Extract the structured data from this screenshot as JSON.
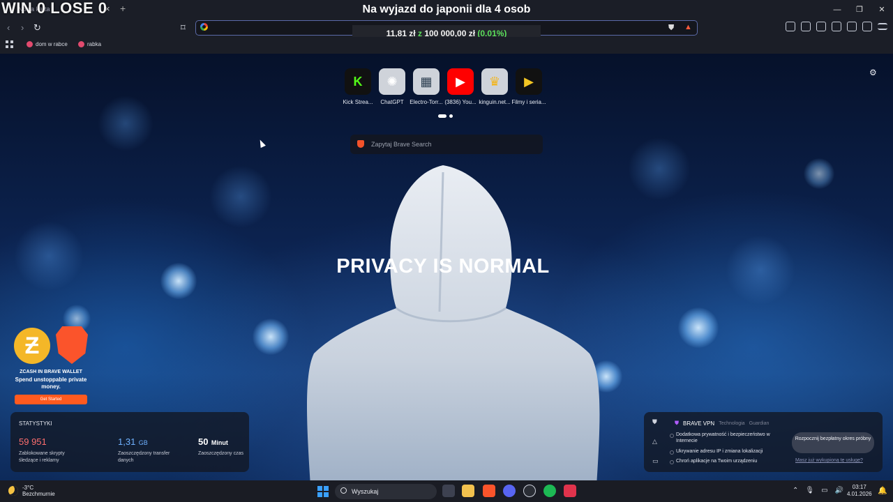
{
  "overlay": {
    "score": "WIN 0 LOSE 0"
  },
  "window": {
    "title": "Na wyjazd do japonii dla 4 osob",
    "tab_label": "Nowa karta"
  },
  "stream_goal": {
    "current": "11,81 zł",
    "separator": "z",
    "target": "100 000,00 zł",
    "percent": "(0.01%)"
  },
  "bookmarks": [
    {
      "label": "dom w rabce",
      "icon": "bookmark-favicon-icon"
    },
    {
      "label": "rabka",
      "icon": "bookmark-favicon-icon"
    }
  ],
  "tiles": [
    {
      "label": "Kick Strea...",
      "glyph": "K",
      "color": "#53fc18",
      "bg": "#111"
    },
    {
      "label": "ChatGPT",
      "glyph": "✺",
      "color": "#ffffff",
      "bg": "#cfd3da"
    },
    {
      "label": "Electro-Torr...",
      "glyph": "▦",
      "color": "#2c3e50",
      "bg": "#cfd3da"
    },
    {
      "label": "(3836) You...",
      "glyph": "▶",
      "color": "#ffffff",
      "bg": "#ff0000"
    },
    {
      "label": "kinguin.net...",
      "glyph": "♛",
      "color": "#f3b51b",
      "bg": "#cfd3da"
    },
    {
      "label": "Filmy i seria...",
      "glyph": "▶",
      "color": "#f3c623",
      "bg": "#111"
    }
  ],
  "search": {
    "placeholder": "Zapytaj Brave Search"
  },
  "hero": {
    "text": "PRIVACY IS NORMAL"
  },
  "promo": {
    "title": "ZCASH IN BRAVE WALLET",
    "subtitle": "Spend unstoppable private money.",
    "cta": "Get Started"
  },
  "stats": {
    "header": "STATYSTYKI",
    "items": [
      {
        "value": "59 951",
        "unit": "",
        "desc": "Zablokowane skrypty śledzące i reklamy",
        "color": "#ff6e6e"
      },
      {
        "value": "1,31",
        "unit": "GB",
        "desc": "Zaoszczędzony transfer danych",
        "color": "#6fb1ff"
      },
      {
        "value": "50",
        "unit": "Minut",
        "desc": "Zaoszczędzony czas",
        "color": "#ffffff"
      }
    ]
  },
  "vpn": {
    "title": "BRAVE VPN",
    "subtitle": "Technologia",
    "partner": "Guardian",
    "features": [
      "Dodatkowa prywatność i bezpieczeństwo w Internecie",
      "Ukrywanie adresu IP i zmiana lokalizacji",
      "Chroń aplikacje na Twoim urządzeniu"
    ],
    "trial_button": "Rozpocznij bezpłatny okres próbny",
    "link": "Masz już wykupioną tę usługę?"
  },
  "taskbar": {
    "weather_temp": "-3°C",
    "weather_desc": "Bezchmurnie",
    "search_label": "Wyszukaj",
    "time": "03:17",
    "date": "4.01.2026"
  }
}
